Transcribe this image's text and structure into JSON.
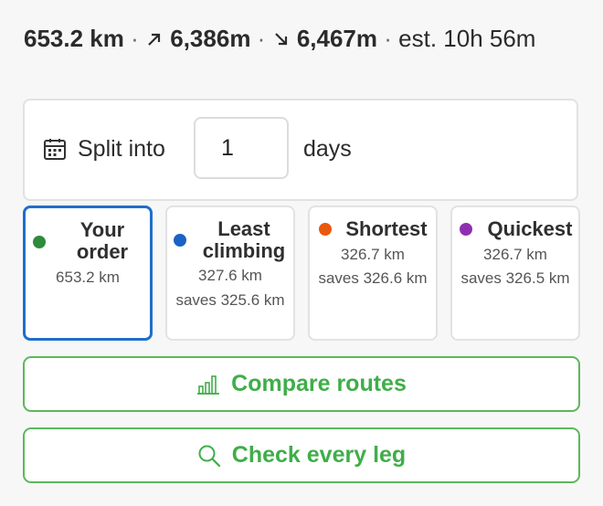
{
  "summary": {
    "distance": "653.2 km",
    "separator": "·",
    "ascent": "6,386m",
    "descent": "6,467m",
    "estimate": "est. 10h 56m"
  },
  "split": {
    "label": "Split into",
    "value": "1",
    "unit": "days",
    "icon": "calendar-icon"
  },
  "route_options": [
    {
      "title": "Your order",
      "detail": "653.2 km",
      "saves": "",
      "color": "#2e8b3a",
      "selected": true
    },
    {
      "title": "Least climbing",
      "detail": "327.6 km",
      "saves": "saves 325.6 km",
      "color": "#1a63c4",
      "selected": false
    },
    {
      "title": "Shortest",
      "detail": "326.7 km",
      "saves": "saves 326.6 km",
      "color": "#e8590c",
      "selected": false
    },
    {
      "title": "Quickest",
      "detail": "326.7 km",
      "saves": "saves 326.5 km",
      "color": "#8e2fb0",
      "selected": false
    }
  ],
  "actions": {
    "compare_label": "Compare routes",
    "compare_icon": "bar-chart-icon",
    "check_label": "Check every leg",
    "check_icon": "search-icon"
  },
  "colors": {
    "accent_green": "#3fae49",
    "selected_blue": "#1f6fc8"
  }
}
